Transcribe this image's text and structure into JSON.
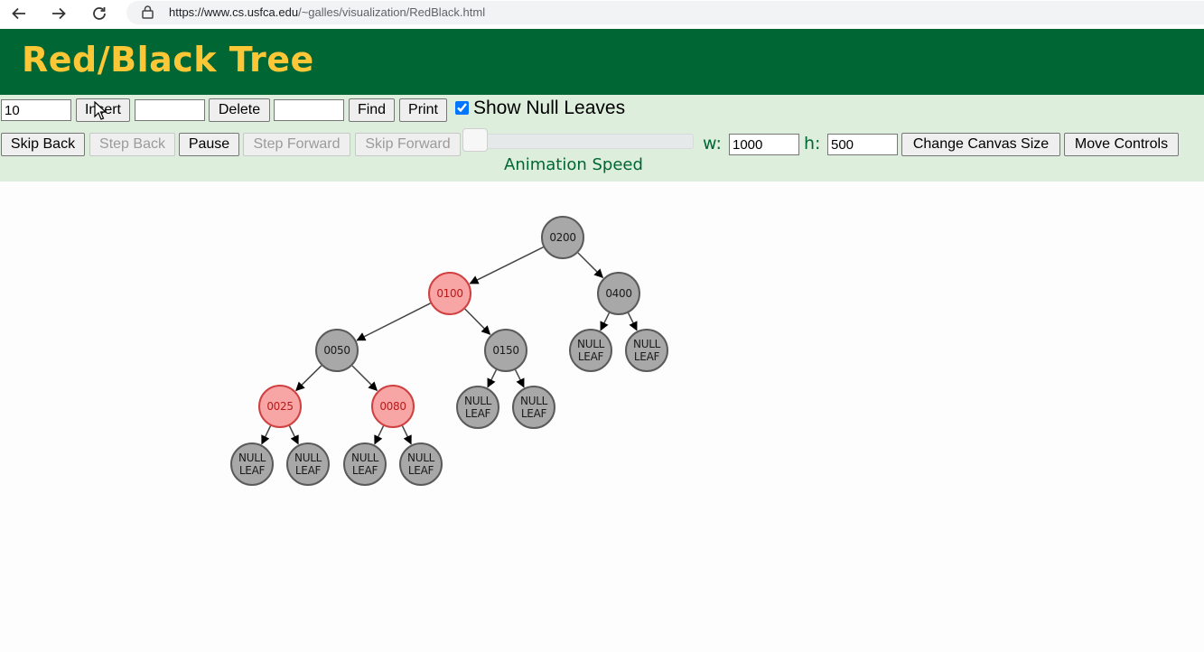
{
  "browser": {
    "url_host": "https://www.cs.usfca.edu",
    "url_path": "/~galles/visualization/RedBlack.html"
  },
  "header": {
    "title": "Red/Black Tree",
    "bg_color": "#006633",
    "title_color": "#fcc737"
  },
  "controls": {
    "insert_value": "10",
    "insert_label": "Insert",
    "delete_value": "",
    "delete_label": "Delete",
    "find_value": "",
    "find_label": "Find",
    "print_label": "Print",
    "show_null_leaves_label": "Show Null Leaves",
    "show_null_leaves_checked": true,
    "skip_back_label": "Skip Back",
    "step_back_label": "Step Back",
    "pause_label": "Pause",
    "step_forward_label": "Step Forward",
    "skip_forward_label": "Skip Forward",
    "animation_speed_label": "Animation Speed",
    "animation_speed_level": 0.0,
    "width_label": "w:",
    "width_value": "1000",
    "height_label": "h:",
    "height_value": "500",
    "change_canvas_size_label": "Change Canvas Size",
    "move_controls_label": "Move Controls"
  },
  "tree": {
    "nodes": [
      {
        "key": "n200",
        "label": "0200",
        "color": "black"
      },
      {
        "key": "n100",
        "label": "0100",
        "color": "red"
      },
      {
        "key": "n400",
        "label": "0400",
        "color": "black"
      },
      {
        "key": "n050",
        "label": "0050",
        "color": "black"
      },
      {
        "key": "n150",
        "label": "0150",
        "color": "black"
      },
      {
        "key": "n025",
        "label": "0025",
        "color": "red"
      },
      {
        "key": "n080",
        "label": "0080",
        "color": "red"
      }
    ],
    "null_leaf_label": "NULL LEAF",
    "null_leaf_line1": "NULL",
    "null_leaf_line2": "LEAF",
    "edges": [
      [
        "n200",
        "n100"
      ],
      [
        "n200",
        "n400"
      ],
      [
        "n100",
        "n050"
      ],
      [
        "n100",
        "n150"
      ],
      [
        "n400",
        "l400a"
      ],
      [
        "n400",
        "l400b"
      ],
      [
        "n050",
        "n025"
      ],
      [
        "n050",
        "n080"
      ],
      [
        "n150",
        "l150a"
      ],
      [
        "n150",
        "l150b"
      ],
      [
        "n025",
        "l025a"
      ],
      [
        "n025",
        "l025b"
      ],
      [
        "n080",
        "l080a"
      ],
      [
        "n080",
        "l080b"
      ]
    ],
    "red_color": "#f8a5a5",
    "black_color": "#a8a8a8"
  }
}
